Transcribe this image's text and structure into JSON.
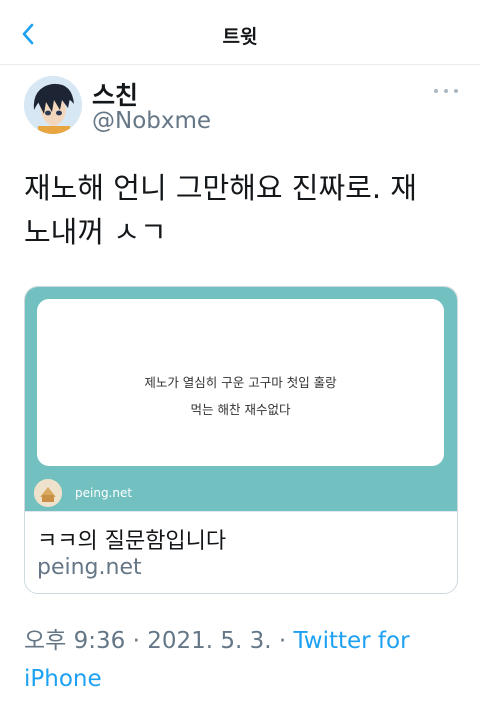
{
  "nav": {
    "title": "트윗",
    "back_icon": "chevron-left-icon",
    "accent": "#1da1f2"
  },
  "author": {
    "name": "스친",
    "handle": "@Nobxme",
    "avatar_icon": "anime-avatar-icon"
  },
  "tweet": {
    "text_line1": "재노해 언니 그만해요 진짜로. 재",
    "text_line2": "노내꺼 ㅅㄱ"
  },
  "card": {
    "image_bg": "#72c1c0",
    "question_line1": "제노가 열심히 구운 고구마 첫입 홀랑",
    "question_line2": "먹는 해찬 재수없다",
    "site_label": "peing.net",
    "title": "ㅋㅋ의 질문함입니다",
    "domain": "peing.net"
  },
  "meta": {
    "time": "오후 9:36",
    "separator": " · ",
    "date": "2021. 5. 3.",
    "client_line1": "Twitter for",
    "client_line2": "iPhone"
  }
}
